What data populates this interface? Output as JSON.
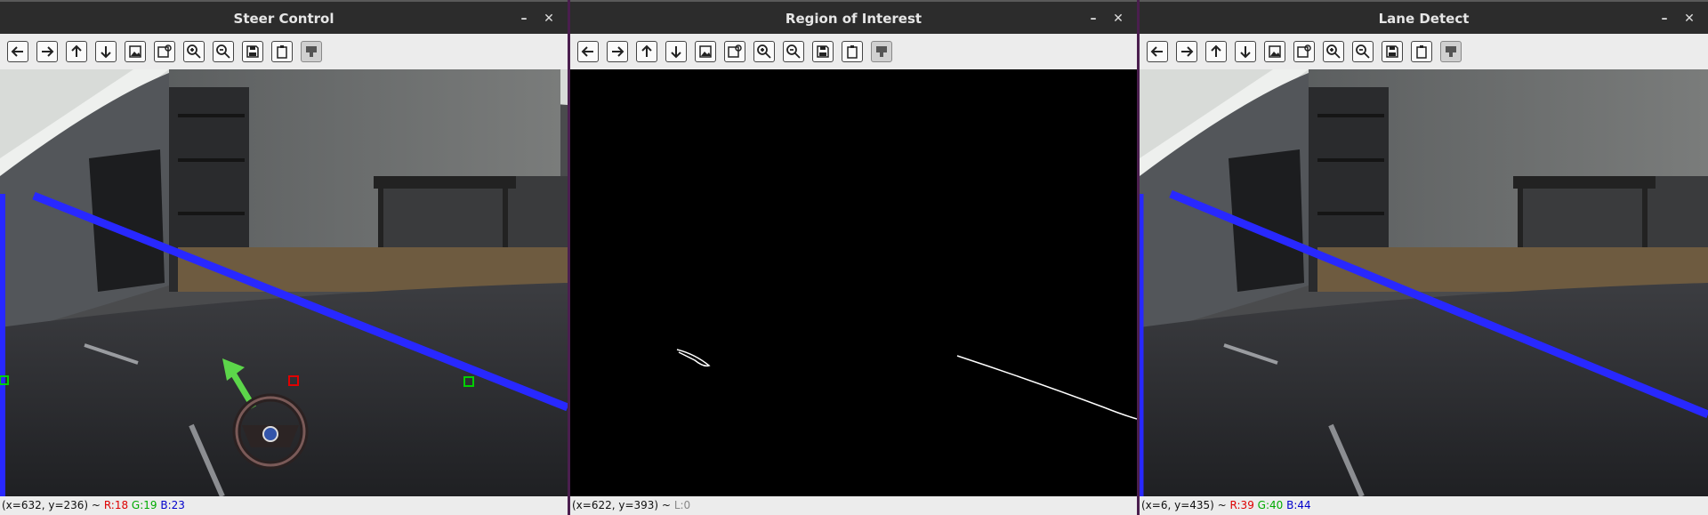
{
  "windows": [
    {
      "id": "steer",
      "title": "Steer Control",
      "status": {
        "coords": "(x=632, y=236) ~",
        "r": "R:18",
        "g": "G:19",
        "b": "B:23"
      }
    },
    {
      "id": "roi",
      "title": "Region of Interest",
      "status": {
        "coords": "(x=622, y=393) ~",
        "l": "L:0"
      }
    },
    {
      "id": "lane",
      "title": "Lane Detect",
      "status": {
        "coords": "(x=6, y=435) ~",
        "r": "R:39",
        "g": "G:40",
        "b": "B:44"
      }
    }
  ],
  "toolbar_icons": [
    "arrow-left-icon",
    "arrow-right-icon",
    "arrow-up-icon",
    "arrow-down-icon",
    "image-icon",
    "image-zoom-icon",
    "zoom-in-icon",
    "zoom-out-icon",
    "save-icon",
    "clipboard-icon",
    "properties-icon"
  ],
  "window_controls": {
    "minimize": "–",
    "close": "✕"
  },
  "colors": {
    "lane_line": "#2828ff",
    "marker_green": "#00d000",
    "marker_red": "#e00000",
    "steer_arrow": "#5cd64a"
  }
}
